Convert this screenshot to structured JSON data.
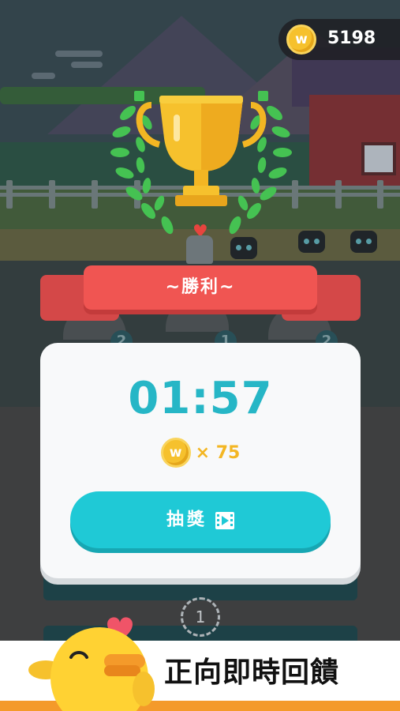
{
  "hud": {
    "coin_symbol": "w",
    "coin_total": "5198"
  },
  "result": {
    "title": "~勝利~",
    "time": "01:57",
    "reward_coin_symbol": "w",
    "reward_multiplier": "× 75",
    "draw_button_label": "抽獎",
    "draw_button_icon": "video-play-icon"
  },
  "background": {
    "badge_left": "2",
    "badge_middle": "1",
    "badge_right": "2",
    "queue_number": "1"
  },
  "banner": {
    "caption": "正向即時回饋",
    "mascot": "yellow-bird-mascot"
  },
  "colors": {
    "accent_teal": "#1fc9d6",
    "timer_teal": "#26b6c6",
    "ribbon_red": "#f05552",
    "coin_gold": "#f6c12d",
    "banner_orange": "#f49a2a"
  }
}
